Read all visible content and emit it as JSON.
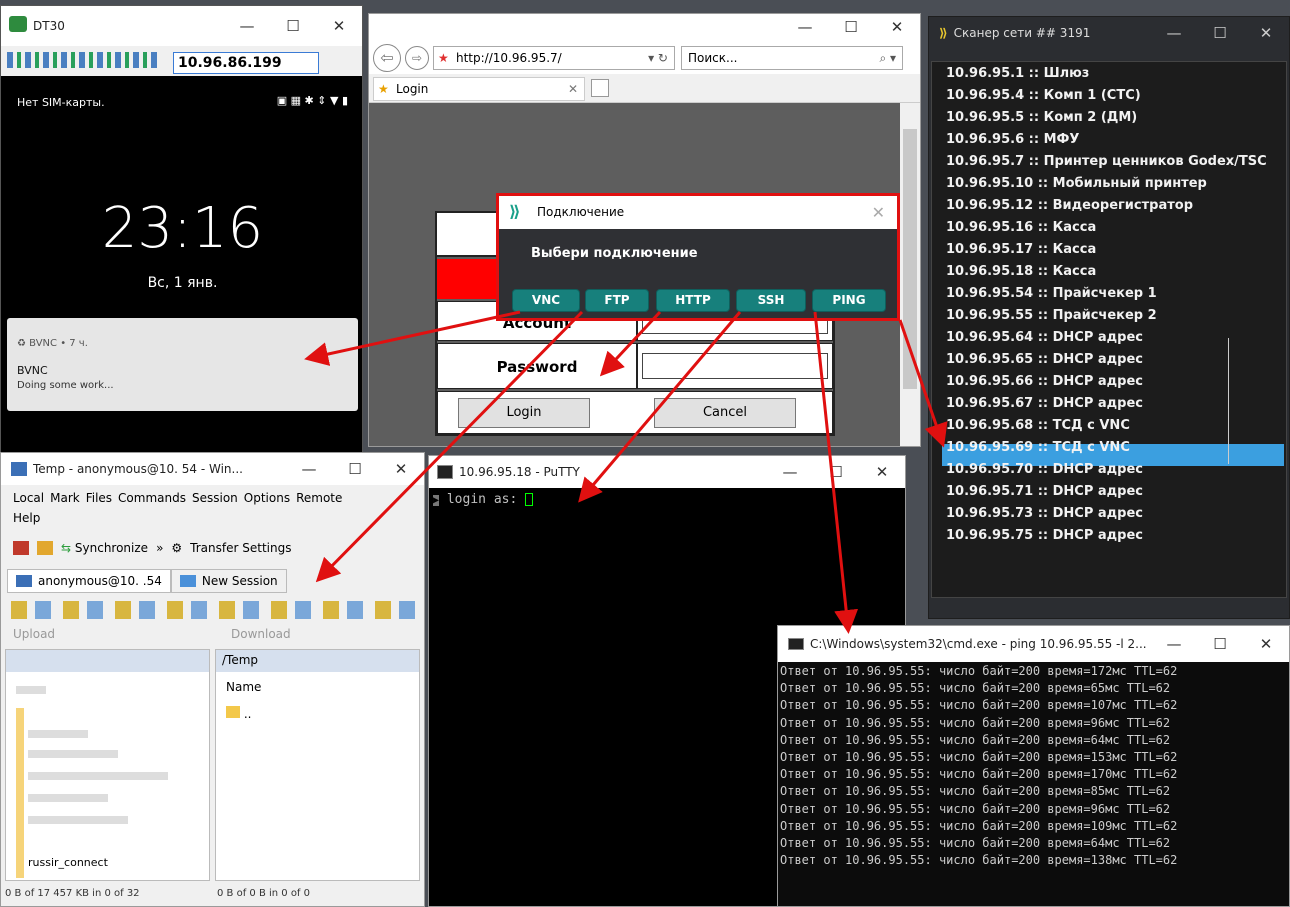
{
  "phone": {
    "title": "DT30",
    "ip": "10.96.86.199",
    "status_left": "Нет SIM-карты.",
    "time": "23:16",
    "date": "Вс, 1 янв.",
    "notif_head": "BVNC • 7 ч.",
    "notif_title": "BVNC",
    "notif_text": "Doing some work..."
  },
  "browser": {
    "url": "http://10.96.95.7/",
    "search_placeholder": "Поиск...",
    "tab": "Login",
    "account_label": "Account",
    "password_label": "Password",
    "login_btn": "Login",
    "cancel_btn": "Cancel"
  },
  "dialog": {
    "title": "Подключение",
    "prompt": "Выбери подключение",
    "buttons": [
      "VNC",
      "FTP",
      "HTTP",
      "SSH",
      "PING"
    ]
  },
  "scanner": {
    "title": "Сканер сети ## 3191",
    "rows": [
      "10.96.95.1 :: Шлюз",
      "10.96.95.4 :: Комп 1 (СТС)",
      "10.96.95.5 :: Комп 2 (ДМ)",
      "10.96.95.6 :: МФУ",
      "10.96.95.7 :: Принтер ценников  Godex/TSC",
      "10.96.95.10 :: Мобильный принтер",
      "10.96.95.12 :: Видеорегистратор",
      "10.96.95.16 :: Касса",
      "10.96.95.17 :: Касса",
      "10.96.95.18 :: Касса",
      "10.96.95.54 :: Прайсчекер 1",
      "10.96.95.55 :: Прайсчекер 2",
      "10.96.95.64 :: DHCP адрес",
      "10.96.95.65 :: DHCP адрес",
      "10.96.95.66 :: DHCP адрес",
      "10.96.95.67 :: DHCP адрес",
      "10.96.95.68 :: ТСД с VNC",
      "10.96.95.69 :: ТСД с VNC",
      "10.96.95.70 :: DHCP адрес",
      "10.96.95.71 :: DHCP адрес",
      "10.96.95.73 :: DHCP адрес",
      "10.96.95.75 :: DHCP адрес"
    ],
    "selected": "10.96.95.69 :: ТСД с VNC"
  },
  "winscp": {
    "title": "Temp - anonymous@10.      54 - Win...",
    "menu": [
      "Local",
      "Mark",
      "Files",
      "Commands",
      "Session",
      "Options",
      "Remote"
    ],
    "menu_help": "Help",
    "sync": "Synchronize",
    "transfer": "Transfer Settings",
    "tab_session": "anonymous@10.      .54",
    "tab_new": "New Session",
    "upload": "Upload",
    "download": "Download",
    "remote_path": "/Temp",
    "col_name": "Name",
    "parent": "..",
    "local_item": "russir_connect",
    "status_left": "0 B of 17 457 KB in 0 of 32",
    "status_right": "0 B of 0 B in 0 of 0"
  },
  "putty": {
    "title": "10.96.95.18 - PuTTY",
    "prompt": "login as: "
  },
  "cmd": {
    "title": "C:\\Windows\\system32\\cmd.exe - ping  10.96.95.55 -l 2...",
    "lines": [
      "Ответ от 10.96.95.55: число байт=200 время=172мс TTL=62",
      "Ответ от 10.96.95.55: число байт=200 время=65мс TTL=62",
      "Ответ от 10.96.95.55: число байт=200 время=107мс TTL=62",
      "Ответ от 10.96.95.55: число байт=200 время=96мс TTL=62",
      "Ответ от 10.96.95.55: число байт=200 время=64мс TTL=62",
      "Ответ от 10.96.95.55: число байт=200 время=153мс TTL=62",
      "Ответ от 10.96.95.55: число байт=200 время=170мс TTL=62",
      "Ответ от 10.96.95.55: число байт=200 время=85мс TTL=62",
      "Ответ от 10.96.95.55: число байт=200 время=96мс TTL=62",
      "Ответ от 10.96.95.55: число байт=200 время=109мс TTL=62",
      "Ответ от 10.96.95.55: число байт=200 время=64мс TTL=62",
      "Ответ от 10.96.95.55: число байт=200 время=138мс TTL=62"
    ]
  },
  "colors": {
    "accent": "#e01010",
    "teal": "#17807c",
    "select": "#3b9fe0"
  }
}
